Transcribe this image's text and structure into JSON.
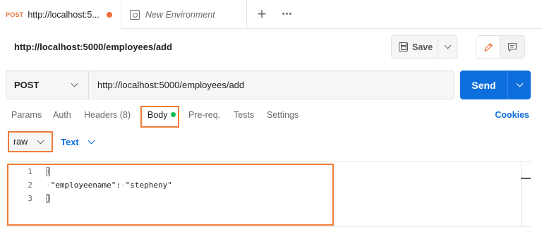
{
  "tabs": {
    "active": {
      "method": "POST",
      "title": "http://localhost:5...",
      "unsaved": true
    },
    "environment": {
      "label": "New Environment"
    },
    "add_icon": "plus-icon",
    "more_icon": "ellipsis-icon"
  },
  "request": {
    "title": "http://localhost:5000/employees/add",
    "save_label": "Save",
    "method": "POST",
    "url": "http://localhost:5000/employees/add",
    "send_label": "Send"
  },
  "request_tabs": {
    "params": "Params",
    "auth": "Auth",
    "headers": "Headers (8)",
    "body": "Body",
    "prereq": "Pre-req.",
    "tests": "Tests",
    "settings": "Settings",
    "cookies": "Cookies"
  },
  "body_options": {
    "mode": "raw",
    "format": "Text"
  },
  "editor": {
    "line_numbers": [
      "1",
      "2",
      "3"
    ],
    "open_brace": "{",
    "key": "\"employeename\":",
    "value": "\"stepheny\"",
    "close_brace": "}"
  },
  "colors": {
    "accent": "#0d6fde",
    "highlight": "#ee7d3a",
    "unsaved_dot": "#f26b3a",
    "body_dot": "#0cbb52"
  }
}
